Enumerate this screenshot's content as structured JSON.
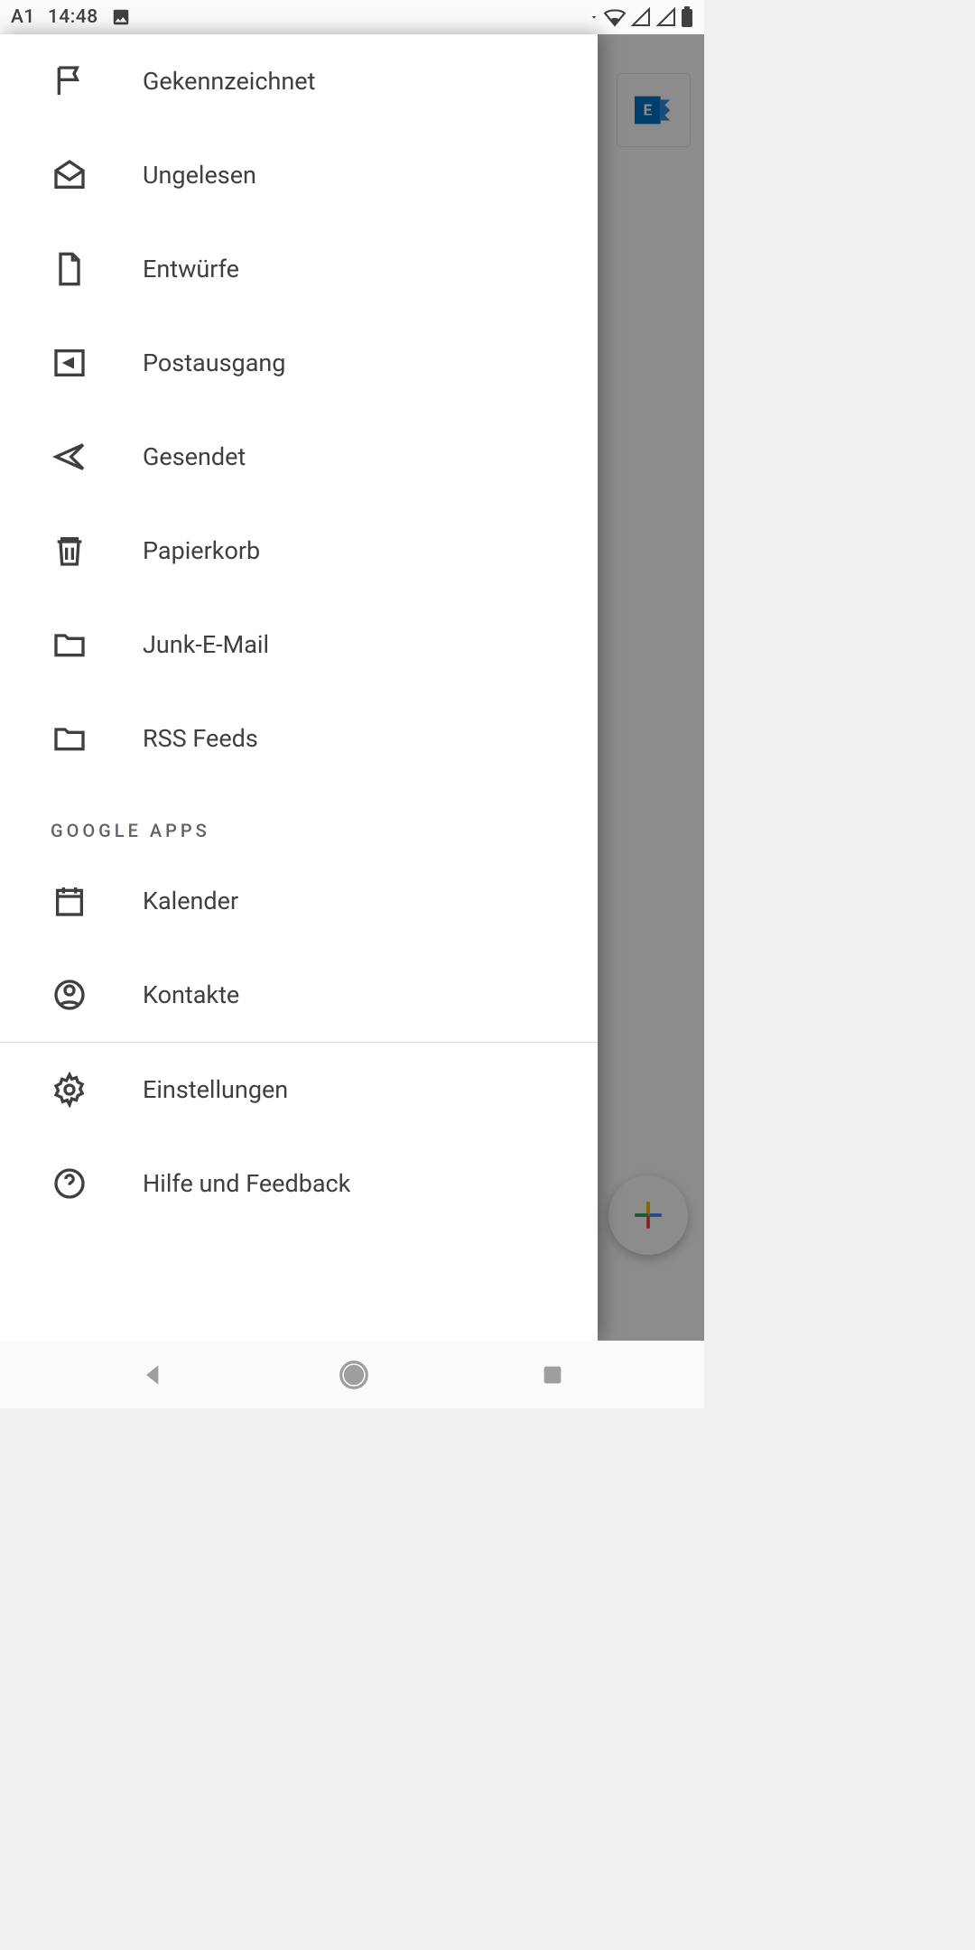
{
  "status": {
    "carrier": "A1",
    "time": "14:48"
  },
  "drawer": {
    "folders": [
      {
        "id": "flagged",
        "label": "Gekennzeichnet"
      },
      {
        "id": "unread",
        "label": "Ungelesen"
      },
      {
        "id": "drafts",
        "label": "Entwürfe"
      },
      {
        "id": "outbox",
        "label": "Postausgang"
      },
      {
        "id": "sent",
        "label": "Gesendet"
      },
      {
        "id": "trash",
        "label": "Papierkorb"
      },
      {
        "id": "junk",
        "label": "Junk-E-Mail"
      },
      {
        "id": "rss",
        "label": "RSS Feeds"
      }
    ],
    "google_section": "GOOGLE APPS",
    "apps": [
      {
        "id": "calendar",
        "label": "Kalender"
      },
      {
        "id": "contacts",
        "label": "Kontakte"
      }
    ],
    "footer": [
      {
        "id": "settings",
        "label": "Einstellungen"
      },
      {
        "id": "help",
        "label": "Hilfe und Feedback"
      }
    ]
  }
}
